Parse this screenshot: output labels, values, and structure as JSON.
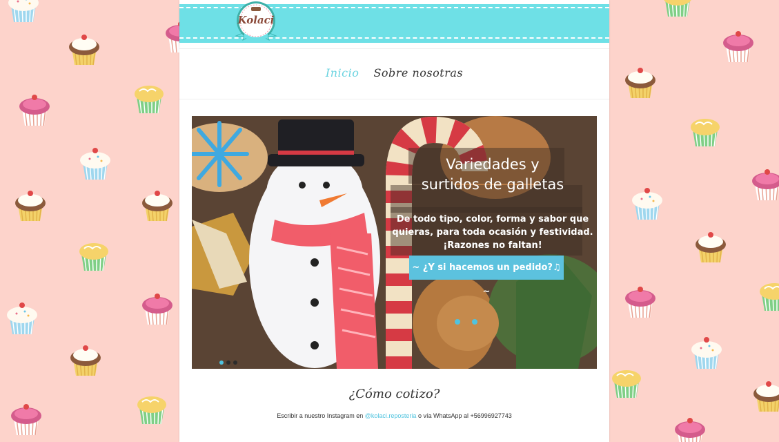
{
  "brand": {
    "logo_text": "Kolaci",
    "ribbon_color": "#6ee0e6",
    "accent": "#6ad3e0"
  },
  "nav": {
    "items": [
      {
        "label": "Inicio",
        "active": true
      },
      {
        "label": "Sobre nosotras",
        "active": false
      }
    ]
  },
  "slider": {
    "title_line1": "Variedades y",
    "title_line2": "surtidos de galletas",
    "text_line1": "De todo tipo, color, forma y sabor que",
    "text_line2": "quieras, para toda ocasión y festividad.",
    "text_line3": "¡Razones no faltan!",
    "button_label": "~ ¿Y si hacemos un pedido?♫ ~",
    "slides_count": 3,
    "active_slide": 1
  },
  "quote": {
    "title": "¿Cómo cotizo?",
    "text_before": "Escribir a nuestro  Instagram en ",
    "instagram_link": "@kolaci.reposteria",
    "text_after": " o vía WhatsApp al +56996927743"
  }
}
